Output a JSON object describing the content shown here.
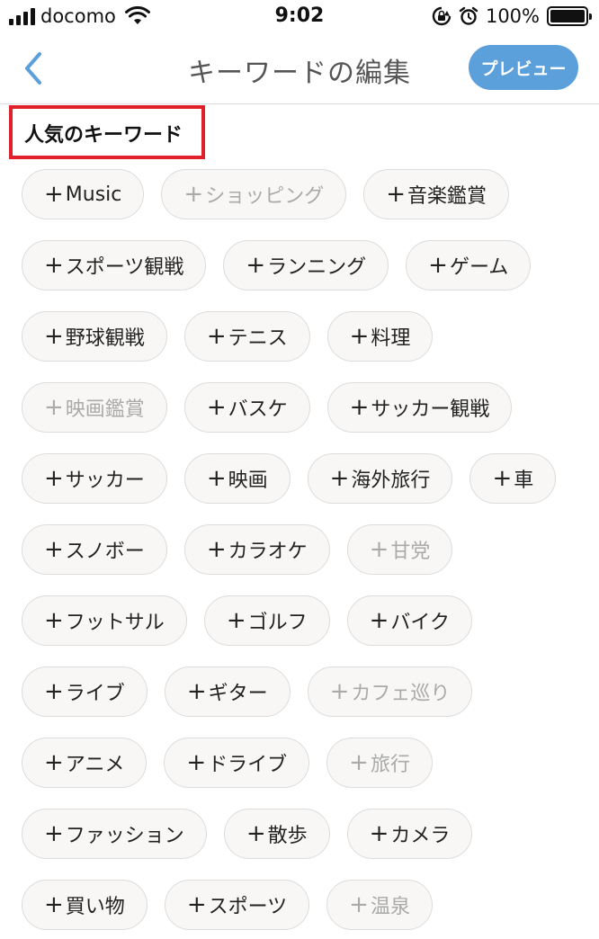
{
  "status_bar": {
    "carrier": "docomo",
    "time": "9:02",
    "battery": "100%"
  },
  "nav": {
    "title": "キーワードの編集",
    "preview_label": "プレビュー"
  },
  "section": {
    "title": "人気のキーワード"
  },
  "keywords": [
    {
      "label": "Music",
      "enabled": true
    },
    {
      "label": "ショッピング",
      "enabled": false
    },
    {
      "label": "音楽鑑賞",
      "enabled": true
    },
    {
      "label": "スポーツ観戦",
      "enabled": true
    },
    {
      "label": "ランニング",
      "enabled": true
    },
    {
      "label": "ゲーム",
      "enabled": true
    },
    {
      "label": "野球観戦",
      "enabled": true
    },
    {
      "label": "テニス",
      "enabled": true
    },
    {
      "label": "料理",
      "enabled": true
    },
    {
      "label": "映画鑑賞",
      "enabled": false
    },
    {
      "label": "バスケ",
      "enabled": true
    },
    {
      "label": "サッカー観戦",
      "enabled": true
    },
    {
      "label": "サッカー",
      "enabled": true
    },
    {
      "label": "映画",
      "enabled": true
    },
    {
      "label": "海外旅行",
      "enabled": true
    },
    {
      "label": "車",
      "enabled": true
    },
    {
      "label": "スノボー",
      "enabled": true
    },
    {
      "label": "カラオケ",
      "enabled": true
    },
    {
      "label": "甘党",
      "enabled": false
    },
    {
      "label": "フットサル",
      "enabled": true
    },
    {
      "label": "ゴルフ",
      "enabled": true
    },
    {
      "label": "バイク",
      "enabled": true
    },
    {
      "label": "ライブ",
      "enabled": true
    },
    {
      "label": "ギター",
      "enabled": true
    },
    {
      "label": "カフェ巡り",
      "enabled": false
    },
    {
      "label": "アニメ",
      "enabled": true
    },
    {
      "label": "ドライブ",
      "enabled": true
    },
    {
      "label": "旅行",
      "enabled": false
    },
    {
      "label": "ファッション",
      "enabled": true
    },
    {
      "label": "散歩",
      "enabled": true
    },
    {
      "label": "カメラ",
      "enabled": true
    },
    {
      "label": "買い物",
      "enabled": true
    },
    {
      "label": "スポーツ",
      "enabled": true
    },
    {
      "label": "温泉",
      "enabled": false
    }
  ],
  "plus_symbol": "+",
  "colors": {
    "accent": "#5b9fdb",
    "highlight_border": "#e0202a",
    "chip_background": "#f8f7f5",
    "chip_disabled_text": "#aaaaaa"
  }
}
